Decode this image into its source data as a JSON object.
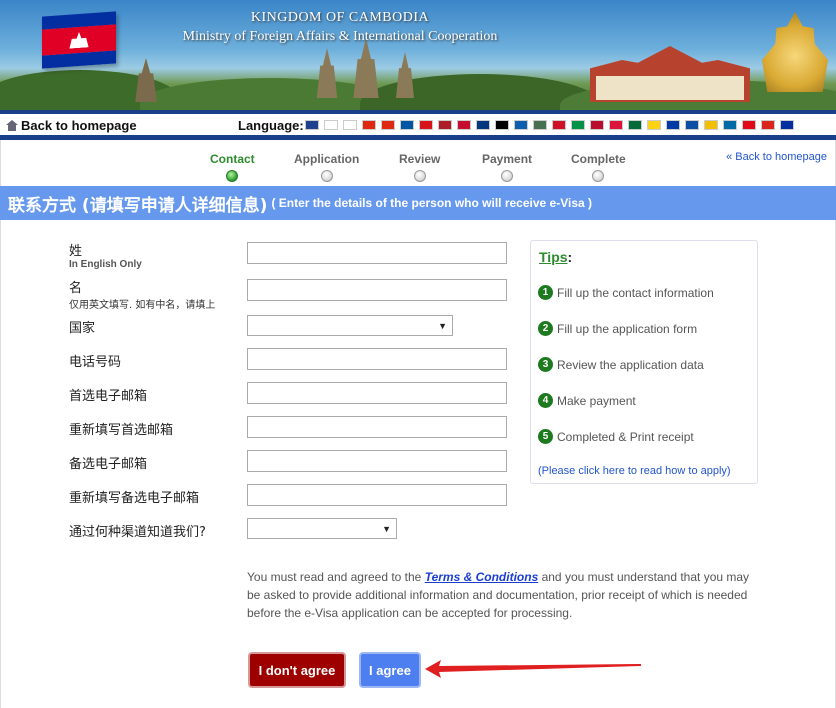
{
  "banner": {
    "title_line1": "KINGDOM OF CAMBODIA",
    "title_line2": "Ministry of Foreign Affairs & International Cooperation"
  },
  "nav": {
    "back_home": "Back to homepage",
    "language_label": "Language:",
    "flags": [
      {
        "name": "uk-flag",
        "color": "#1f3f8f"
      },
      {
        "name": "korea-flag",
        "color": "#ffffff"
      },
      {
        "name": "japan-flag",
        "color": "#ffffff"
      },
      {
        "name": "china-flag",
        "color": "#de2910"
      },
      {
        "name": "taiwan-flag",
        "color": "#de2910"
      },
      {
        "name": "france-flag",
        "color": "#0055a4"
      },
      {
        "name": "czech-flag",
        "color": "#d7141a"
      },
      {
        "name": "netherlands-flag",
        "color": "#ae1c28"
      },
      {
        "name": "denmark-flag",
        "color": "#c60c30"
      },
      {
        "name": "finland-flag",
        "color": "#003580"
      },
      {
        "name": "germany-flag",
        "color": "#000000"
      },
      {
        "name": "greece-flag",
        "color": "#0d5eaf"
      },
      {
        "name": "hungary-flag",
        "color": "#477050"
      },
      {
        "name": "indonesia-flag",
        "color": "#ce1126"
      },
      {
        "name": "italy-flag",
        "color": "#009246"
      },
      {
        "name": "norway-flag",
        "color": "#ba0c2f"
      },
      {
        "name": "poland-flag",
        "color": "#dc143c"
      },
      {
        "name": "portugal-flag",
        "color": "#046a38"
      },
      {
        "name": "romania-flag",
        "color": "#fcd116"
      },
      {
        "name": "russia-flag",
        "color": "#0039a6"
      },
      {
        "name": "slovakia-flag",
        "color": "#0b4ea2"
      },
      {
        "name": "spain-flag",
        "color": "#f1bf00"
      },
      {
        "name": "sweden-flag",
        "color": "#006aa7"
      },
      {
        "name": "turkey-flag",
        "color": "#e30a17"
      },
      {
        "name": "vietnam-flag",
        "color": "#da251d"
      },
      {
        "name": "cambodia-flag",
        "color": "#032ea1"
      }
    ]
  },
  "steps": {
    "items": [
      {
        "label": "Contact",
        "active": true
      },
      {
        "label": "Application",
        "active": false
      },
      {
        "label": "Review",
        "active": false
      },
      {
        "label": "Payment",
        "active": false
      },
      {
        "label": "Complete",
        "active": false
      }
    ],
    "back_link": "« Back to homepage"
  },
  "section": {
    "title_zh": "联系方式 (请填写申请人详细信息)",
    "title_en": "( Enter the details of the person who will receive e-Visa )"
  },
  "form": {
    "surname_label": "姓",
    "surname_sub": "In English Only",
    "given_label": "名",
    "given_sub": "仅用英文填写. 如有中名，请填上",
    "country_label": "国家",
    "phone_label": "电话号码",
    "email_label": "首选电子邮箱",
    "email_confirm_label": "重新填写首选邮箱",
    "alt_email_label": "备选电子邮箱",
    "alt_email_confirm_label": "重新填写备选电子邮箱",
    "referral_label": "通过何种渠道知道我们?"
  },
  "tips": {
    "title": "Tips",
    "colon": ":",
    "items": [
      {
        "num": "1",
        "text": "Fill up the contact information"
      },
      {
        "num": "2",
        "text": "Fill up the application form"
      },
      {
        "num": "3",
        "text": "Review the application data"
      },
      {
        "num": "4",
        "text": "Make payment"
      },
      {
        "num": "5",
        "text": "Completed & Print receipt"
      }
    ],
    "link": "(Please click here to read how to apply)"
  },
  "terms": {
    "before": "You must read and agreed to the ",
    "link": "Terms & Conditions",
    "after": " and you must understand that you may be asked to provide additional information and documentation, prior receipt of which is needed before the e-Visa application can be accepted for processing."
  },
  "buttons": {
    "disagree": "I don't agree",
    "agree": "I agree"
  },
  "colors": {
    "header_blue": "#6699ee",
    "active_step": "#2e8b2e",
    "disagree_red": "#9e0000",
    "agree_blue": "#4d7ff0",
    "annotation_red": "#e02020"
  }
}
